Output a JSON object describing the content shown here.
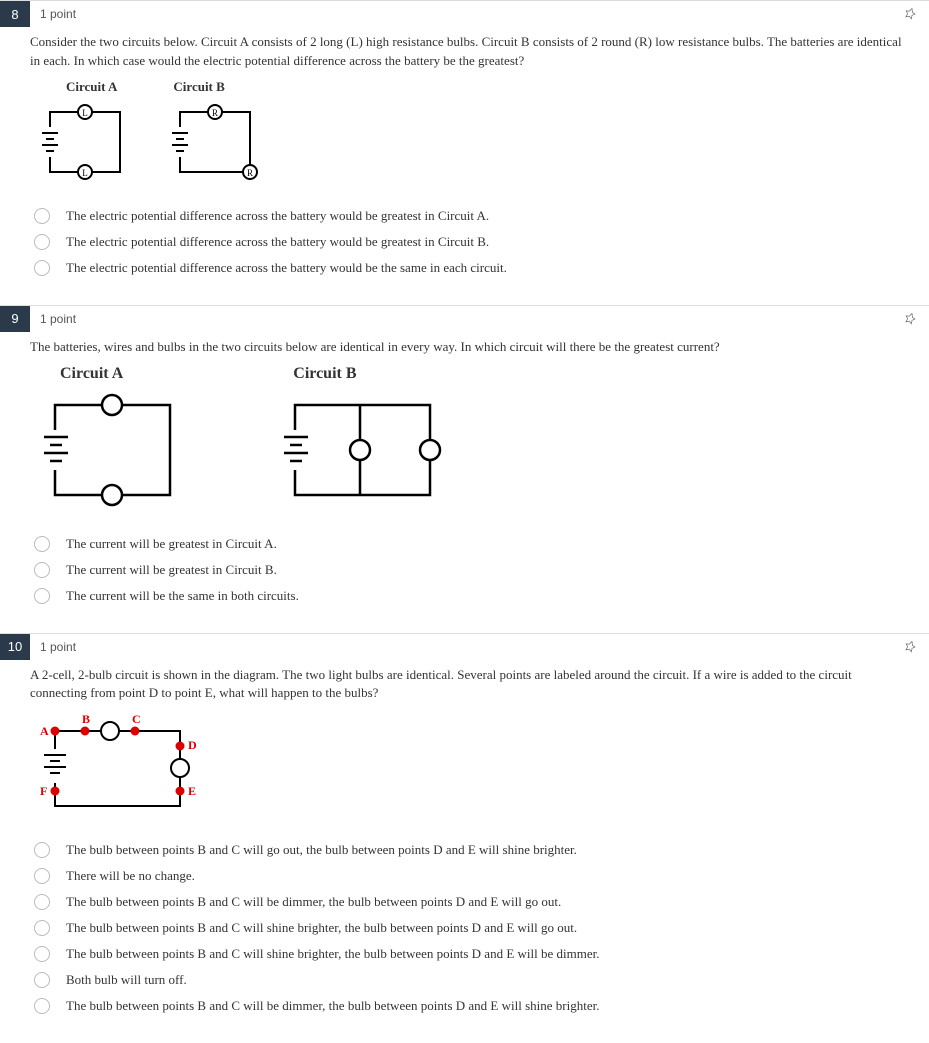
{
  "questions": [
    {
      "number": "8",
      "points": "1 point",
      "prompt": "Consider the two circuits below. Circuit A consists of 2 long (L) high resistance bulbs. Circuit B consists of 2 round (R) low resistance bulbs. The batteries are identical in each. In which case would the electric potential difference across the battery be the greatest?",
      "labelA": "Circuit A",
      "labelB": "Circuit B",
      "options": [
        "The electric potential difference across the battery would be greatest in Circuit A.",
        "The electric potential difference across the battery would be greatest in Circuit B.",
        "The electric potential difference across the battery would be the same in each circuit."
      ]
    },
    {
      "number": "9",
      "points": "1 point",
      "prompt": "The batteries, wires and bulbs in the two circuits below are identical in every way. In which circuit will there be the greatest current?",
      "labelA": "Circuit A",
      "labelB": "Circuit B",
      "options": [
        "The current will be greatest in Circuit A.",
        "The current will be greatest in Circuit B.",
        "The current will be the same in both circuits."
      ]
    },
    {
      "number": "10",
      "points": "1 point",
      "prompt": "A 2-cell, 2-bulb circuit is shown in the diagram. The two light bulbs are identical.  Several points are labeled around the circuit. If a wire is added to the circuit connecting from point D to point E, what will happen to the bulbs?",
      "nodes": {
        "A": "A",
        "B": "B",
        "C": "C",
        "D": "D",
        "E": "E",
        "F": "F"
      },
      "options": [
        "The bulb between points B and C will go out, the bulb between points D and E will shine brighter.",
        "There will be no change.",
        "The bulb between points B and C will be dimmer, the bulb between points D and E will go out.",
        "The bulb between points B and C will shine brighter, the bulb between points D and E will go out.",
        "The bulb between points B and C will shine brighter, the bulb between points D and E will be dimmer.",
        "Both bulb will turn off.",
        "The bulb between points B and C will be dimmer, the bulb between points D and E will shine brighter."
      ]
    }
  ]
}
